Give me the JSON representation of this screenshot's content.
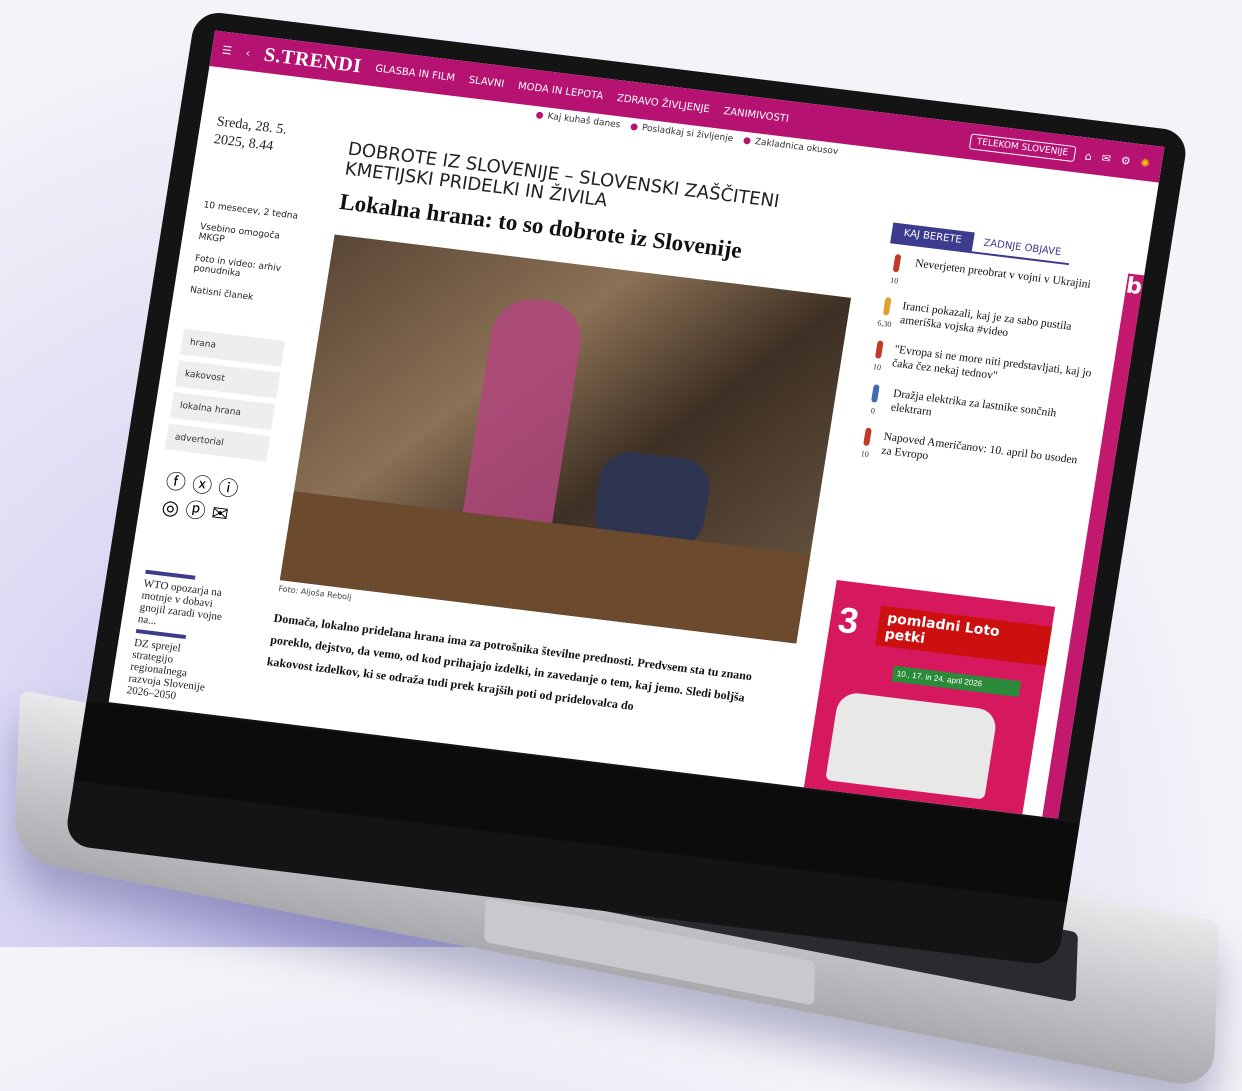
{
  "site": {
    "brand": "S.TRENDI",
    "nav": [
      "GLASBA IN FILM",
      "SLAVNI",
      "MODA IN LEPOTA",
      "ZDRAVO ŽIVLJENJE",
      "ZANIMIVOSTI"
    ],
    "top_right": "TELEKOM SLOVENIJE",
    "subnav": [
      "Kaj kuhaš danes",
      "Posladkaj si življenje",
      "Zakladnica okusov"
    ]
  },
  "article": {
    "date": "Sreda, 28. 5. 2025, 8.44",
    "age": "10 mesecev, 2 tedna",
    "sponsor": "Vsebino omogoča MKGP",
    "photo_credit": "Foto in video: arhiv ponudnika",
    "print": "Natisni članek",
    "tags": [
      "hrana",
      "kakovost",
      "lokalna hrana",
      "advertorial"
    ],
    "kicker": "DOBROTE IZ SLOVENIJE – SLOVENSKI ZAŠČITENI KMETIJSKI PRIDELKI IN ŽIVILA",
    "headline": "Lokalna hrana: to so dobrote iz Slovenije",
    "caption": "Foto: Aljoša Rebolj",
    "lead": "Domača, lokalno pridelana hrana ima za potrošnika številne prednosti. Predvsem sta tu znano poreklo, dejstvo, da vemo, od kod prihajajo izdelki, in zavedanje o tem, kaj jemo. Sledi boljša kakovost izdelkov, ki se odraža tudi prek krajših poti od pridelovalca do"
  },
  "related": [
    {
      "title": "WTO opozarja na motnje v dobavi gnojil zaradi vojne na..."
    },
    {
      "title": "DZ sprejel strategijo regionalnega razvoja Slovenije 2026–2050"
    }
  ],
  "sidebar": {
    "tab_active": "KAJ BERETE",
    "tab_other": "ZADNJE OBJAVE",
    "items": [
      {
        "title": "Neverjeten preobrat v vojni v Ukrajini",
        "score": "10"
      },
      {
        "title": "Iranci pokazali, kaj je za sabo pustila ameriška vojska #video",
        "score": "6,30"
      },
      {
        "title": "\"Evropa si ne more niti predstavljati, kaj jo čaka čez nekaj tednov\"",
        "score": "10"
      },
      {
        "title": "Dražja elektrika za lastnike sončnih elektrarn",
        "score": "0"
      },
      {
        "title": "Napoved Američanov: 10. april bo usoden za Evropo",
        "score": "10"
      }
    ]
  },
  "ad": {
    "number": "3",
    "title": "pomladni Loto petki",
    "dates": "10., 17. in 24. april 2026"
  },
  "ad_edge": "bar"
}
